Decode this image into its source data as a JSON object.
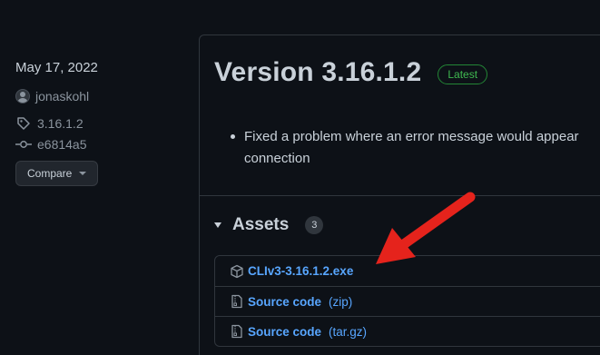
{
  "meta": {
    "date": "May 17, 2022",
    "author": "jonaskohl",
    "tag": "3.16.1.2",
    "commit": "e6814a5",
    "compare_label": "Compare"
  },
  "release": {
    "title": "Version 3.16.1.2",
    "badge": "Latest",
    "notes": [
      "Fixed a problem where an error message would appear",
      "connection"
    ]
  },
  "assets": {
    "label": "Assets",
    "count": "3",
    "items": [
      {
        "name": "CLIv3-3.16.1.2.exe",
        "suffix": "",
        "icon": "package-icon"
      },
      {
        "name": "Source code",
        "suffix": "(zip)",
        "icon": "file-zip-icon"
      },
      {
        "name": "Source code",
        "suffix": "(tar.gz)",
        "icon": "file-zip-icon"
      }
    ]
  },
  "colors": {
    "background": "#0d1117",
    "link": "#58a6ff",
    "badge": "#3fb950",
    "annotation_arrow": "#e5231c"
  }
}
